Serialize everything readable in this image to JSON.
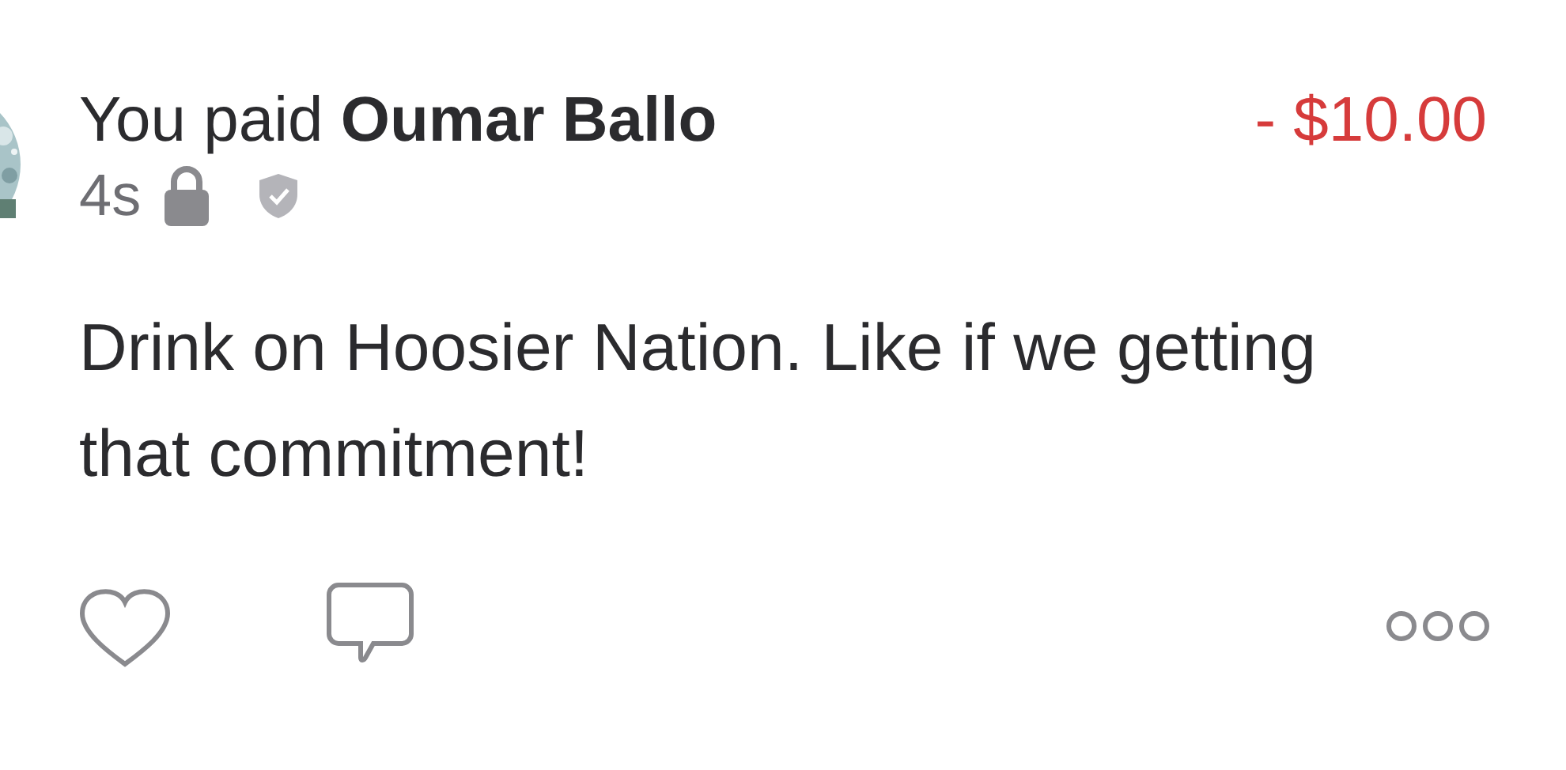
{
  "story": {
    "prefix": "You paid",
    "name": "Oumar Ballo",
    "amount": "- $10.00",
    "time": "4s",
    "private": true,
    "verified": true,
    "message": "Drink on Hoosier Nation. Like if we getting that commitment!",
    "liked": false
  }
}
